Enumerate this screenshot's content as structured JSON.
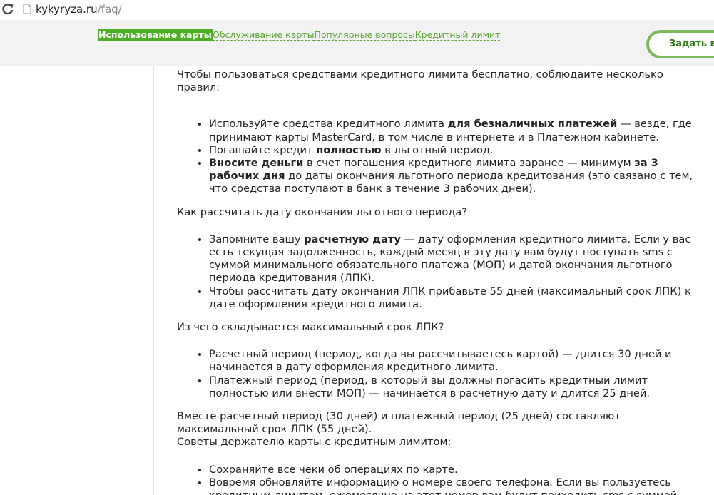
{
  "browser": {
    "url_host": "kykyryza.ru",
    "url_path": "/faq/"
  },
  "nav": {
    "tabs": [
      {
        "label": "Использование карты",
        "active": true
      },
      {
        "label": "Обслуживание карты",
        "active": false
      },
      {
        "label": "Популярные вопросы",
        "active": false
      },
      {
        "label": "Кредитный лимит",
        "active": false
      }
    ],
    "ask_button": "Задать в"
  },
  "content": {
    "intro": "Чтобы пользоваться средствами кредитного лимита бесплатно, соблюдайте несколько правил:",
    "rules": [
      {
        "parts": [
          "Используйте средства кредитного лимита ",
          "для безналичных платежей",
          " — везде, где принимают карты MasterCard, в том числе в интернете и в Платежном кабинете."
        ]
      },
      {
        "parts": [
          "Погашайте кредит ",
          "полностью",
          " в льготный период."
        ]
      },
      {
        "parts": [
          "Вносите деньги",
          " в счет погашения кредитного лимита заранее — минимум ",
          "за 3 рабочих дня",
          " до даты окончания льготного периода кредитования (это связано с тем, что средства поступают в банк в течение 3 рабочих дней)."
        ]
      }
    ],
    "q1": "Как рассчитать дату окончания льготного периода?",
    "q1_items": [
      {
        "parts": [
          "Запомните вашу ",
          "расчетную дату",
          " — дату оформления кредитного лимита. Если у вас есть текущая задолженность, каждый месяц в эту дату вам будут поступать sms с суммой минимального обязательного платежа (МОП) и датой окончания льготного периода кредитования (ЛПК)."
        ]
      },
      {
        "text": "Чтобы рассчитать дату окончания ЛПК прибавьте 55 дней (максимальный срок ЛПК) к дате оформления кредитного лимита."
      }
    ],
    "q2": "Из чего складывается максимальный срок ЛПК?",
    "q2_items": [
      "Расчетный период (период, когда вы рассчитываетесь картой) — длится 30 дней и начинается в дату оформления кредитного лимита.",
      "Платежный период (период, в который вы должны погасить кредитный лимит полностью или внести МОП) — начинается в расчетную дату и длится 25 дней."
    ],
    "summary": "Вместе расчетный период (30 дней) и платежный период (25 дней) составляют максимальный срок ЛПК (55 дней).",
    "tips_title": "Советы держателю карты с кредитным лимитом:",
    "tips": [
      "Сохраняйте все чеки об операциях по карте.",
      "Вовремя обновляйте информацию о номере своего телефона. Если вы пользуетесь кредитным лимитом, ежемесячно на этот номер вам будут приходить sms с суммой МОП."
    ]
  }
}
